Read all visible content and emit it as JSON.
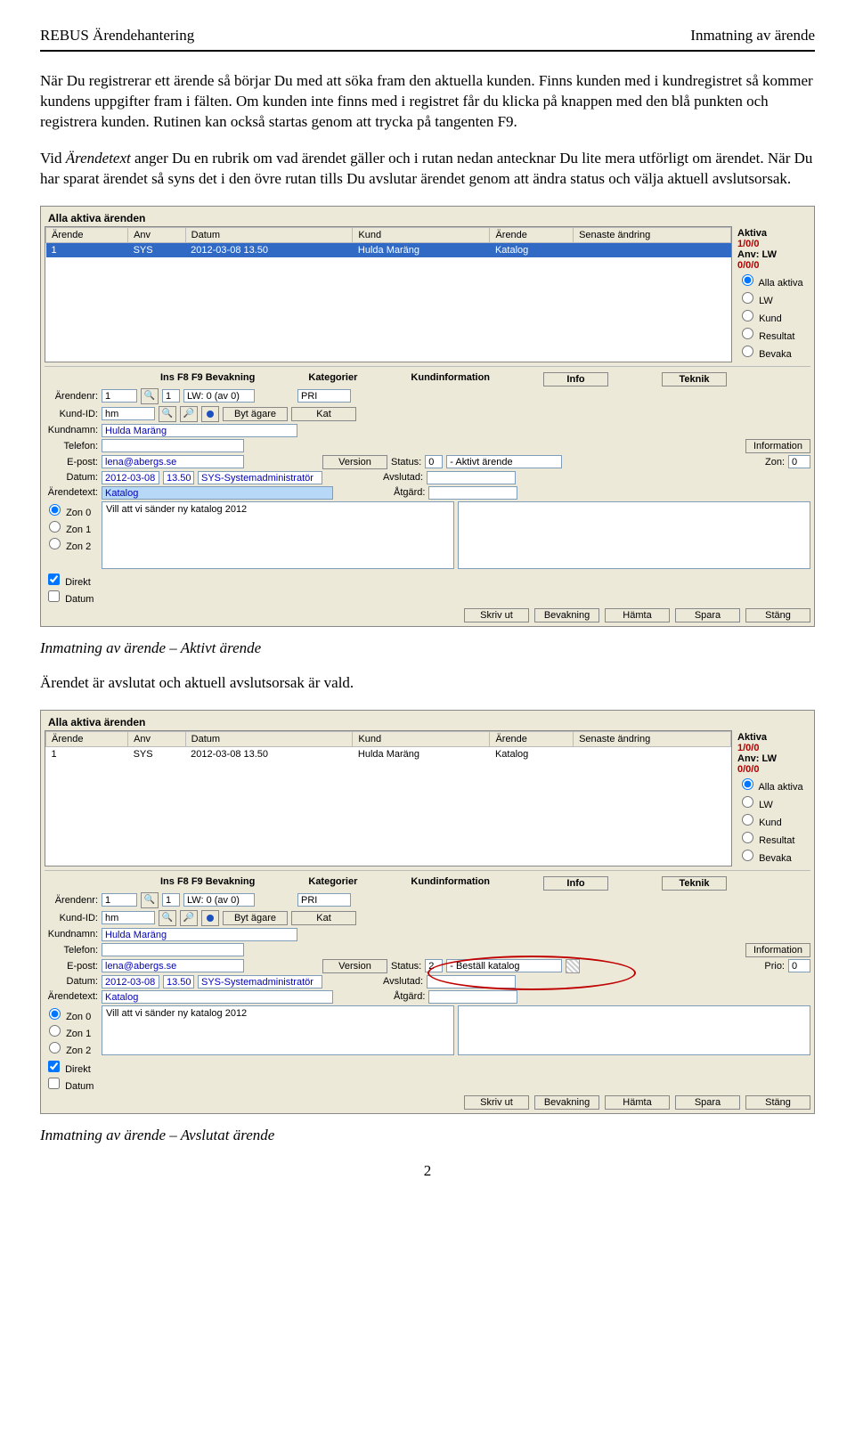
{
  "header": {
    "left": "REBUS Ärendehantering",
    "right": "Inmatning av ärende"
  },
  "paragraphs": {
    "p1": "När Du registrerar ett ärende så börjar Du med att söka fram den aktuella kunden. Finns kunden med i kundregistret så kommer kundens uppgifter fram i fälten. Om kunden inte finns med i registret får du klicka på knappen med den blå punkten och registrera kunden. Rutinen kan också startas genom att trycka på tangenten F9.",
    "p2a": "Vid ",
    "p2i": "Ärendetext",
    "p2b": " anger Du en rubrik om vad ärendet gäller och i rutan nedan antecknar Du lite mera utförligt om ärendet. När Du har sparat ärendet så syns det i den övre rutan tills Du avslutar ärendet genom att ändra status och välja aktuell avslutsorsak.",
    "cap1": "Inmatning av ärende – Aktivt ärende",
    "p3": "Ärendet är avslutat och aktuell avslutsorsak är vald.",
    "cap2": "Inmatning av ärende – Avslutat ärende"
  },
  "shot": {
    "title": "Alla aktiva ärenden",
    "cols": {
      "c1": "Ärende",
      "c2": "Anv",
      "c3": "Datum",
      "c4": "Kund",
      "c5": "Ärende",
      "c6": "Senaste ändring"
    },
    "row": {
      "r1": "1",
      "r2": "SYS",
      "r3": "2012-03-08 13.50",
      "r4": "Hulda Maräng",
      "r5": "Katalog",
      "r6": ""
    },
    "side": {
      "aktiva": "Aktiva",
      "cnt1": "1/0/0",
      "anv": "Anv: LW",
      "cnt2": "0/0/0",
      "o1": "Alla aktiva",
      "o2": "LW",
      "o3": "Kund",
      "o4": "Resultat",
      "o5": "Bevaka"
    },
    "sec": {
      "ins": "Ins  F8  F9  Bevakning",
      "kat": "Kategorier",
      "kinfo": "Kundinformation",
      "info": "Info",
      "teknik": "Teknik"
    },
    "lbl": {
      "arendenr": "Ärendenr:",
      "kundid": "Kund-ID:",
      "kundnamn": "Kundnamn:",
      "telefon": "Telefon:",
      "epost": "E-post:",
      "datum": "Datum:",
      "arendetext": "Ärendetext:",
      "information": "Information",
      "version": "Version",
      "status": "Status:",
      "avslutad": "Avslutad:",
      "atgard": "Åtgärd:",
      "zon": "Zon:",
      "prio": "Prio:",
      "bytag": "Byt ägare",
      "kat": "Kat",
      "lw": "LW: 0  (av 0)",
      "pri": "PRI"
    },
    "val": {
      "arendenr": "1",
      "arendenr2": "1",
      "kundid": "hm",
      "kundnamn": "Hulda Maräng",
      "epost": "lena@abergs.se",
      "datum": "2012-03-08",
      "tid": "13.50",
      "user": "SYS-Systemadministratör",
      "status1": "0",
      "status1txt": "- Aktivt ärende",
      "status2": "2",
      "status2txt": "- Beställ katalog",
      "zon": "0",
      "prio": "0",
      "arendetext": "Katalog",
      "note": "Vill att vi sänder ny katalog 2012"
    },
    "zones": {
      "z0": "Zon 0",
      "z1": "Zon 1",
      "z2": "Zon 2",
      "direkt": "Direkt",
      "datum": "Datum"
    },
    "btns": {
      "skriv": "Skriv ut",
      "bev": "Bevakning",
      "hamta": "Hämta",
      "spara": "Spara",
      "stang": "Stäng"
    }
  },
  "pagenum": "2"
}
